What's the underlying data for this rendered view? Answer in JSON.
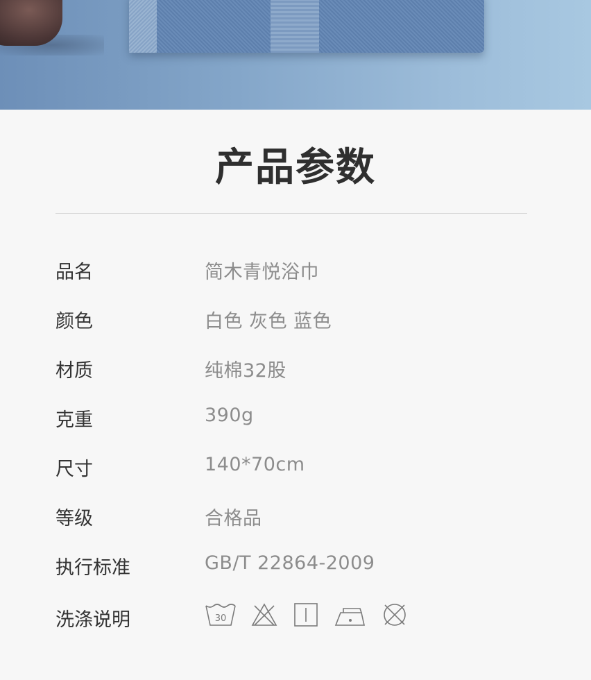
{
  "page": {
    "title": "产品参数"
  },
  "specs": [
    {
      "label": "品名",
      "value": "简木青悦浴巾"
    },
    {
      "label": "颜色",
      "value": "白色 灰色 蓝色"
    },
    {
      "label": "材质",
      "value": "纯棉32股"
    },
    {
      "label": "克重",
      "value": "390g"
    },
    {
      "label": "尺寸",
      "value": "140*70cm"
    },
    {
      "label": "等级",
      "value": "合格品"
    },
    {
      "label": "执行标准",
      "value": "GB/T 22864-2009"
    }
  ],
  "care": {
    "label": "洗涤说明",
    "wash_temp": "30",
    "icons": [
      "wash-30-icon",
      "no-bleach-icon",
      "tumble-line-dry-icon",
      "iron-low-icon",
      "no-dry-clean-icon"
    ]
  },
  "colors": {
    "title": "#2f2f2f",
    "label": "#333333",
    "value": "#8c8c8c",
    "icon": "#7a7a7a",
    "background": "#f7f7f7"
  }
}
